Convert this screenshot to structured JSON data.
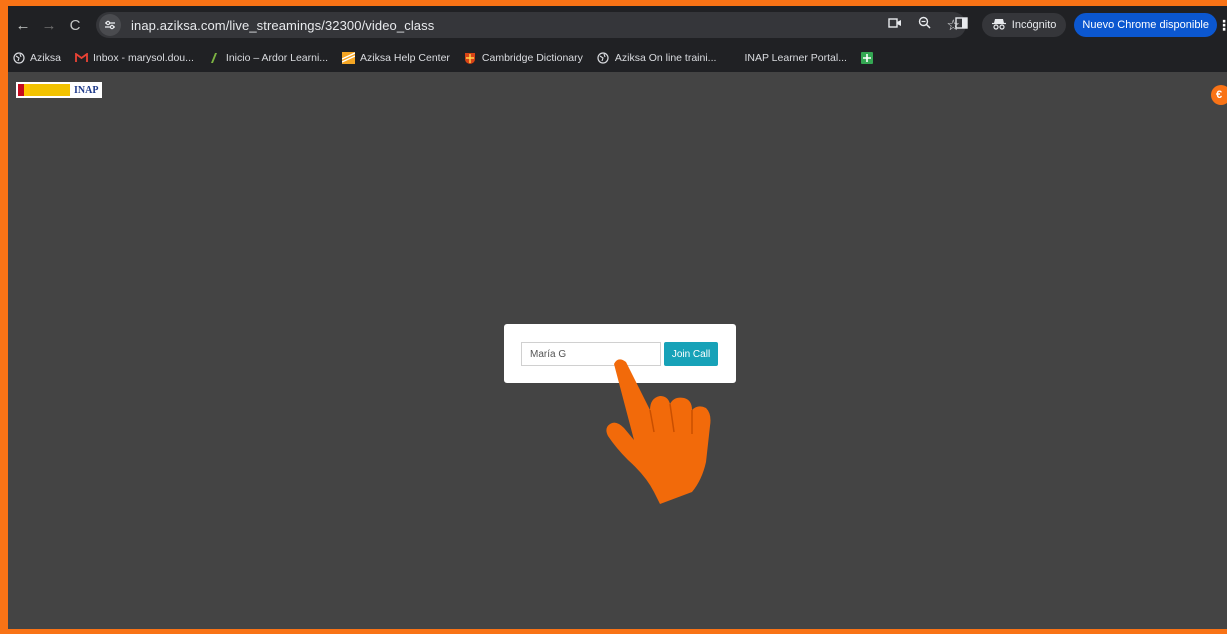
{
  "browser": {
    "url": "inap.aziksa.com/live_streamings/32300/video_class",
    "incognito_label": "Incógnito",
    "update_label": "Nuevo Chrome disponible",
    "nav": {
      "back_icon": "arrow-left-icon",
      "forward_icon": "arrow-right-icon",
      "reload_icon": "reload-icon"
    }
  },
  "bookmarks": [
    {
      "label": "Aziksa",
      "icon": "globe-icon"
    },
    {
      "label": "Inbox - marysol.dou...",
      "icon": "gmail-icon"
    },
    {
      "label": "Inicio – Ardor Learni...",
      "icon": "ardor-icon"
    },
    {
      "label": "Aziksa Help Center",
      "icon": "help-center-icon"
    },
    {
      "label": "Cambridge Dictionary",
      "icon": "cambridge-icon"
    },
    {
      "label": "Aziksa On line traini...",
      "icon": "globe-icon"
    },
    {
      "label": "INAP Learner Portal...",
      "icon": "blank-icon"
    },
    {
      "label": "",
      "icon": "sheets-icon"
    }
  ],
  "page": {
    "logo_text": "INAP",
    "join": {
      "name_value": "María G",
      "button_label": "Join Call"
    }
  },
  "colors": {
    "frame_border": "#f97316",
    "join_button": "#17a2b8",
    "update_chip": "#0b57d0",
    "hand_pointer": "#f26a0a"
  }
}
